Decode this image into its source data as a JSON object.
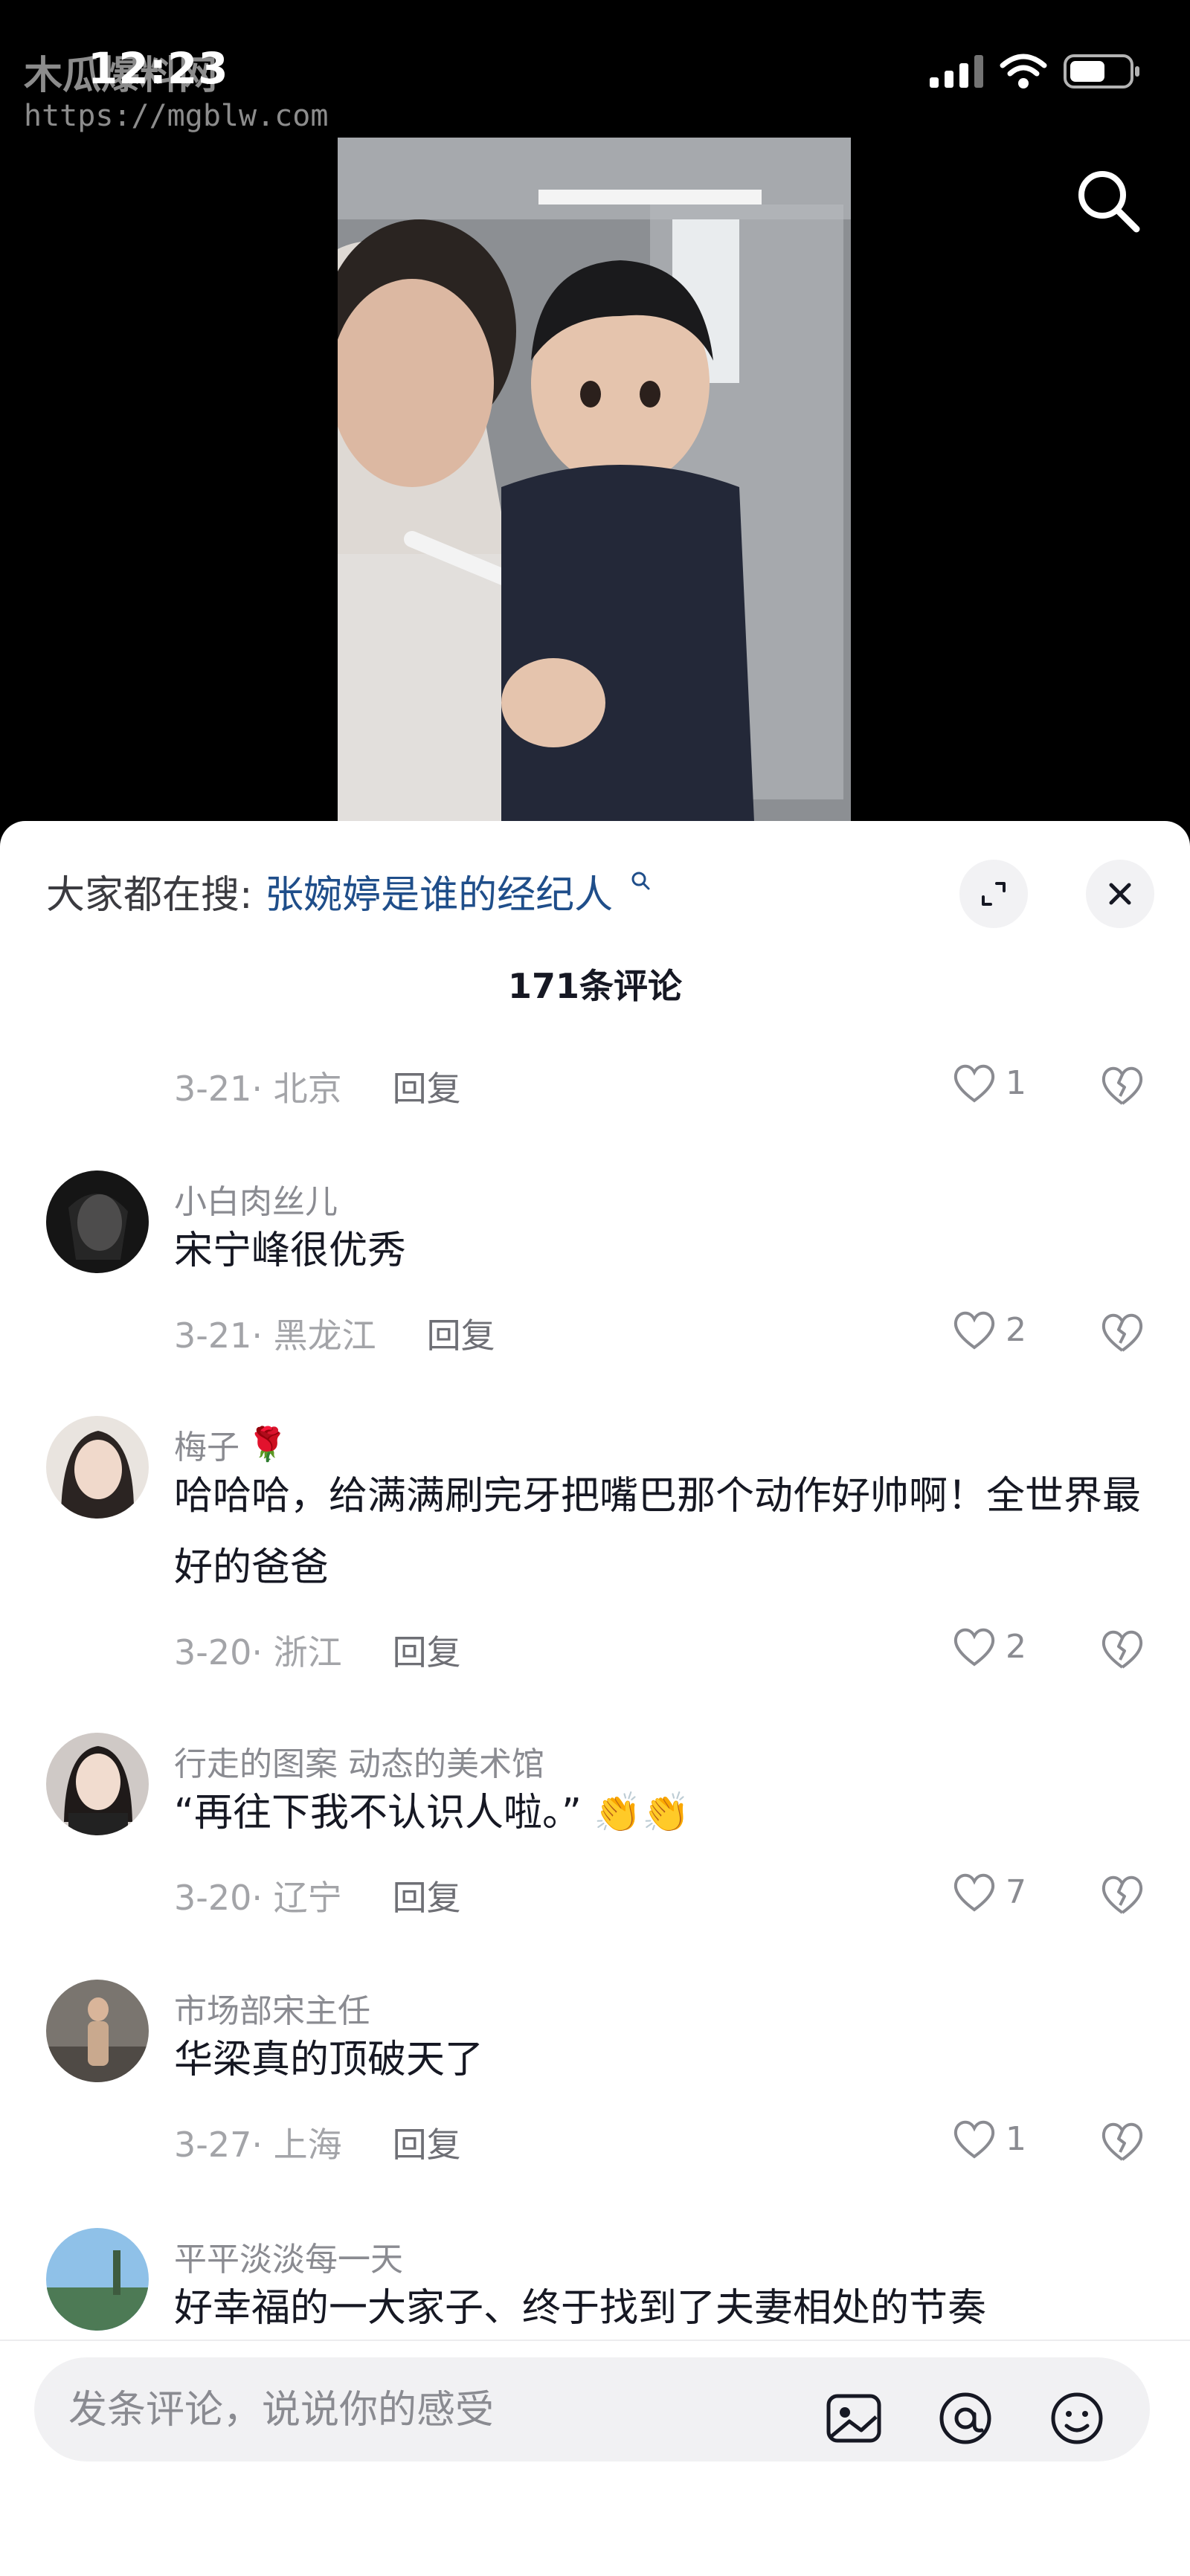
{
  "status_bar": {
    "time": "12:23"
  },
  "watermark": {
    "title": "木瓜爆料网",
    "url": "https://mgblw.com"
  },
  "header": {
    "prefix": "大家都在搜:",
    "trending_query": "张婉婷是谁的经纪人"
  },
  "comments_title": "171条评论",
  "first_meta": {
    "date_location": "3-21· 北京",
    "reply_label": "回复",
    "likes": "1"
  },
  "comments": [
    {
      "user": "小白肉丝儿",
      "text": "宋宁峰很优秀",
      "date_location": "3-21· 黑龙江",
      "reply_label": "回复",
      "likes": "2"
    },
    {
      "user": "梅子",
      "user_emoji": "🌹",
      "text": "哈哈哈，给满满刷完牙把嘴巴那个动作好帅啊！全世界最好的爸爸",
      "date_location": "3-20· 浙江",
      "reply_label": "回复",
      "likes": "2"
    },
    {
      "user": "行走的图案 动态的美术馆",
      "text": "“再往下我不认识人啦。”",
      "text_emoji": "👏👏",
      "date_location": "3-20· 辽宁",
      "reply_label": "回复",
      "likes": "7"
    },
    {
      "user": "市场部宋主任",
      "text": "华梁真的顶破天了",
      "date_location": "3-27· 上海",
      "reply_label": "回复",
      "likes": "1"
    },
    {
      "user": "平平淡淡每一天",
      "text": "好幸福的一大家子、终于找到了夫妻相处的节奏"
    }
  ],
  "input": {
    "placeholder": "发条评论，说说你的感受"
  },
  "colors": {
    "accent_link": "#1f4e8a",
    "meta_gray": "#a3a4a8",
    "sheet_bg": "#ffffff"
  }
}
